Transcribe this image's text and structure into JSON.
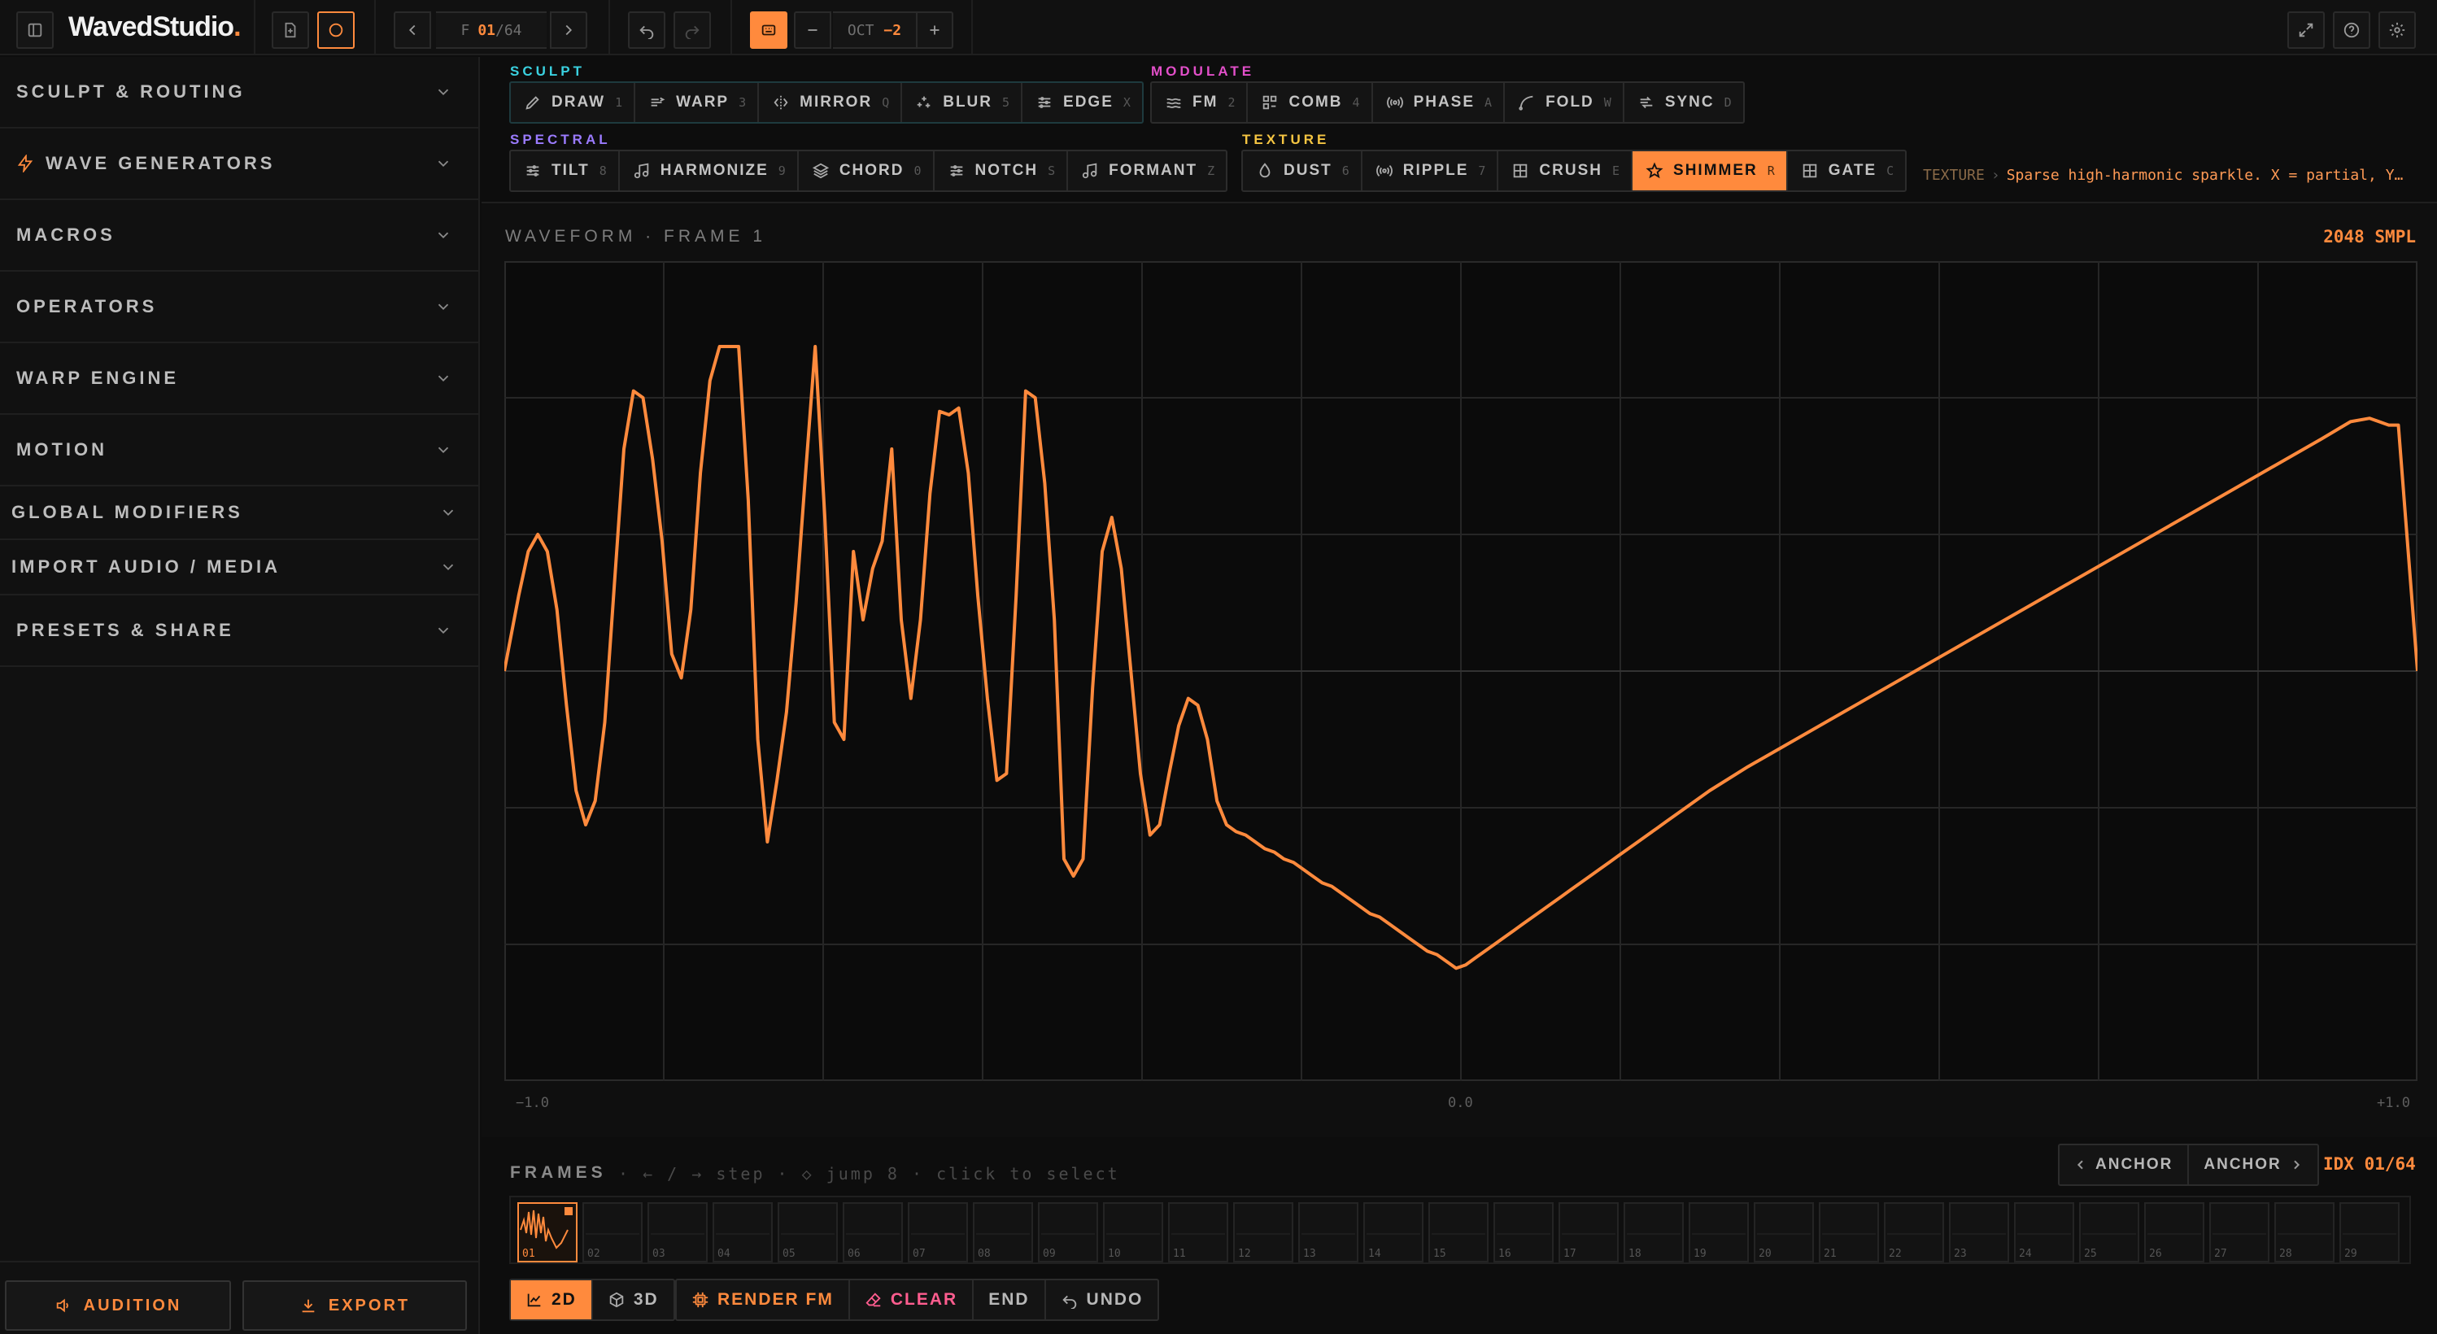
{
  "app": {
    "logo": "WavedStudio",
    "logo_dot": "."
  },
  "topbar": {
    "frame_prefix": "F",
    "frame_current": "01",
    "frame_total": "/64",
    "oct_label": "OCT",
    "oct_value": "−2"
  },
  "sidebar": {
    "sections": [
      {
        "label": "SCULPT & ROUTING"
      },
      {
        "label": "WAVE GENERATORS",
        "icon": "bolt-icon"
      },
      {
        "label": "MACROS"
      },
      {
        "label": "OPERATORS"
      },
      {
        "label": "WARP ENGINE"
      },
      {
        "label": "MOTION"
      },
      {
        "label": "GLOBAL MODIFIERS"
      },
      {
        "label": "IMPORT AUDIO / MEDIA"
      },
      {
        "label": "PRESETS & SHARE"
      }
    ],
    "audition_label": "AUDITION",
    "export_label": "EXPORT"
  },
  "groups": {
    "sculpt": {
      "title": "SCULPT",
      "color": "#3ad1e0",
      "tools": [
        {
          "name": "DRAW",
          "key": "1"
        },
        {
          "name": "WARP",
          "key": "3"
        },
        {
          "name": "MIRROR",
          "key": "Q"
        },
        {
          "name": "BLUR",
          "key": "5"
        },
        {
          "name": "EDGE",
          "key": "X"
        }
      ]
    },
    "modulate": {
      "title": "MODULATE",
      "color": "#e24fc9",
      "tools": [
        {
          "name": "FM",
          "key": "2"
        },
        {
          "name": "COMB",
          "key": "4"
        },
        {
          "name": "PHASE",
          "key": "A"
        },
        {
          "name": "FOLD",
          "key": "W"
        },
        {
          "name": "SYNC",
          "key": "D"
        }
      ]
    },
    "spectral": {
      "title": "SPECTRAL",
      "color": "#9b7bff",
      "tools": [
        {
          "name": "TILT",
          "key": "8"
        },
        {
          "name": "HARMONIZE",
          "key": "9"
        },
        {
          "name": "CHORD",
          "key": "0"
        },
        {
          "name": "NOTCH",
          "key": "S"
        },
        {
          "name": "FORMANT",
          "key": "Z"
        }
      ]
    },
    "texture": {
      "title": "TEXTURE",
      "color": "#f5c542",
      "tools": [
        {
          "name": "DUST",
          "key": "6"
        },
        {
          "name": "RIPPLE",
          "key": "7"
        },
        {
          "name": "CRUSH",
          "key": "E"
        },
        {
          "name": "SHIMMER",
          "key": "R",
          "active": true
        },
        {
          "name": "GATE",
          "key": "C"
        }
      ]
    }
  },
  "texture_info": {
    "label": "TEXTURE",
    "separator": "›",
    "description": "Sparse high-harmonic sparkle. X = partial, Y…"
  },
  "waveform": {
    "title": "WAVEFORM · FRAME 1",
    "samples": "2048 SMPL",
    "x_ticks": [
      "−1.0",
      "0.0",
      "+1.0"
    ],
    "accent": "#ff8a3d"
  },
  "chart_data": {
    "type": "line",
    "title": "WAVEFORM · FRAME 1",
    "xlim": [
      -1.0,
      1.0
    ],
    "ylim": [
      -1.0,
      1.0
    ],
    "grid": true,
    "x_tick_labels": [
      "−1.0",
      "0.0",
      "+1.0"
    ],
    "series": [
      {
        "color": "#ff8a3d",
        "x": [
          -1.0,
          -0.985,
          -0.975,
          -0.965,
          -0.955,
          -0.945,
          -0.935,
          -0.925,
          -0.915,
          -0.905,
          -0.895,
          -0.885,
          -0.875,
          -0.865,
          -0.855,
          -0.845,
          -0.835,
          -0.825,
          -0.815,
          -0.805,
          -0.795,
          -0.785,
          -0.775,
          -0.765,
          -0.755,
          -0.745,
          -0.735,
          -0.725,
          -0.715,
          -0.705,
          -0.695,
          -0.685,
          -0.675,
          -0.665,
          -0.655,
          -0.645,
          -0.635,
          -0.625,
          -0.615,
          -0.605,
          -0.595,
          -0.585,
          -0.575,
          -0.565,
          -0.555,
          -0.545,
          -0.535,
          -0.525,
          -0.515,
          -0.505,
          -0.495,
          -0.485,
          -0.475,
          -0.465,
          -0.455,
          -0.445,
          -0.435,
          -0.425,
          -0.415,
          -0.405,
          -0.395,
          -0.385,
          -0.375,
          -0.365,
          -0.355,
          -0.345,
          -0.335,
          -0.325,
          -0.315,
          -0.305,
          -0.295,
          -0.285,
          -0.275,
          -0.265,
          -0.255,
          -0.245,
          -0.235,
          -0.225,
          -0.215,
          -0.205,
          -0.195,
          -0.185,
          -0.175,
          -0.165,
          -0.155,
          -0.145,
          -0.135,
          -0.125,
          -0.115,
          -0.105,
          -0.095,
          -0.085,
          -0.075,
          -0.065,
          -0.055,
          -0.045,
          -0.035,
          -0.025,
          -0.015,
          -0.005,
          0.005,
          0.015,
          0.025,
          0.035,
          0.045,
          0.055,
          0.065,
          0.075,
          0.085,
          0.095,
          0.105,
          0.115,
          0.125,
          0.135,
          0.145,
          0.155,
          0.165,
          0.175,
          0.185,
          0.195,
          0.205,
          0.215,
          0.225,
          0.235,
          0.245,
          0.26,
          0.3,
          0.4,
          0.5,
          0.6,
          0.7,
          0.8,
          0.9,
          0.93,
          0.95,
          0.97,
          0.98,
          1.0
        ],
        "y": [
          0.0,
          0.22,
          0.35,
          0.4,
          0.35,
          0.18,
          -0.1,
          -0.35,
          -0.45,
          -0.38,
          -0.15,
          0.25,
          0.65,
          0.82,
          0.8,
          0.62,
          0.38,
          0.05,
          -0.02,
          0.18,
          0.58,
          0.85,
          0.95,
          0.95,
          0.95,
          0.5,
          -0.2,
          -0.5,
          -0.32,
          -0.12,
          0.2,
          0.58,
          0.95,
          0.45,
          -0.15,
          -0.2,
          0.35,
          0.15,
          0.3,
          0.38,
          0.65,
          0.15,
          -0.08,
          0.15,
          0.52,
          0.76,
          0.75,
          0.77,
          0.58,
          0.22,
          -0.08,
          -0.32,
          -0.3,
          0.22,
          0.82,
          0.8,
          0.55,
          0.15,
          -0.55,
          -0.6,
          -0.55,
          -0.05,
          0.35,
          0.45,
          0.3,
          0.0,
          -0.3,
          -0.48,
          -0.45,
          -0.3,
          -0.16,
          -0.08,
          -0.1,
          -0.2,
          -0.38,
          -0.45,
          -0.47,
          -0.48,
          -0.5,
          -0.52,
          -0.53,
          -0.55,
          -0.56,
          -0.58,
          -0.6,
          -0.62,
          -0.63,
          -0.65,
          -0.67,
          -0.69,
          -0.71,
          -0.72,
          -0.74,
          -0.76,
          -0.78,
          -0.8,
          -0.82,
          -0.83,
          -0.85,
          -0.87,
          -0.86,
          -0.84,
          -0.82,
          -0.8,
          -0.78,
          -0.76,
          -0.74,
          -0.72,
          -0.7,
          -0.68,
          -0.66,
          -0.64,
          -0.62,
          -0.6,
          -0.58,
          -0.56,
          -0.54,
          -0.52,
          -0.5,
          -0.48,
          -0.46,
          -0.44,
          -0.42,
          -0.4,
          -0.38,
          -0.35,
          -0.28,
          -0.12,
          0.04,
          0.2,
          0.36,
          0.52,
          0.68,
          0.73,
          0.74,
          0.72,
          0.72,
          0.0
        ]
      }
    ]
  },
  "frames": {
    "title": "FRAMES",
    "hint": "· ← / → step · ◇ jump 8 · click to select",
    "anchor_prev": "ANCHOR",
    "anchor_next": "ANCHOR",
    "idx": "IDX 01/64",
    "cells": [
      "01",
      "02",
      "03",
      "04",
      "05",
      "06",
      "07",
      "08",
      "09",
      "10",
      "11",
      "12",
      "13",
      "14",
      "15",
      "16",
      "17",
      "18",
      "19",
      "20",
      "21",
      "22",
      "23",
      "24",
      "25",
      "26",
      "27",
      "28",
      "29"
    ]
  },
  "bottom": {
    "view_2d": "2D",
    "view_3d": "3D",
    "render": "RENDER FM",
    "clear": "CLEAR",
    "end": "END",
    "undo": "UNDO"
  }
}
